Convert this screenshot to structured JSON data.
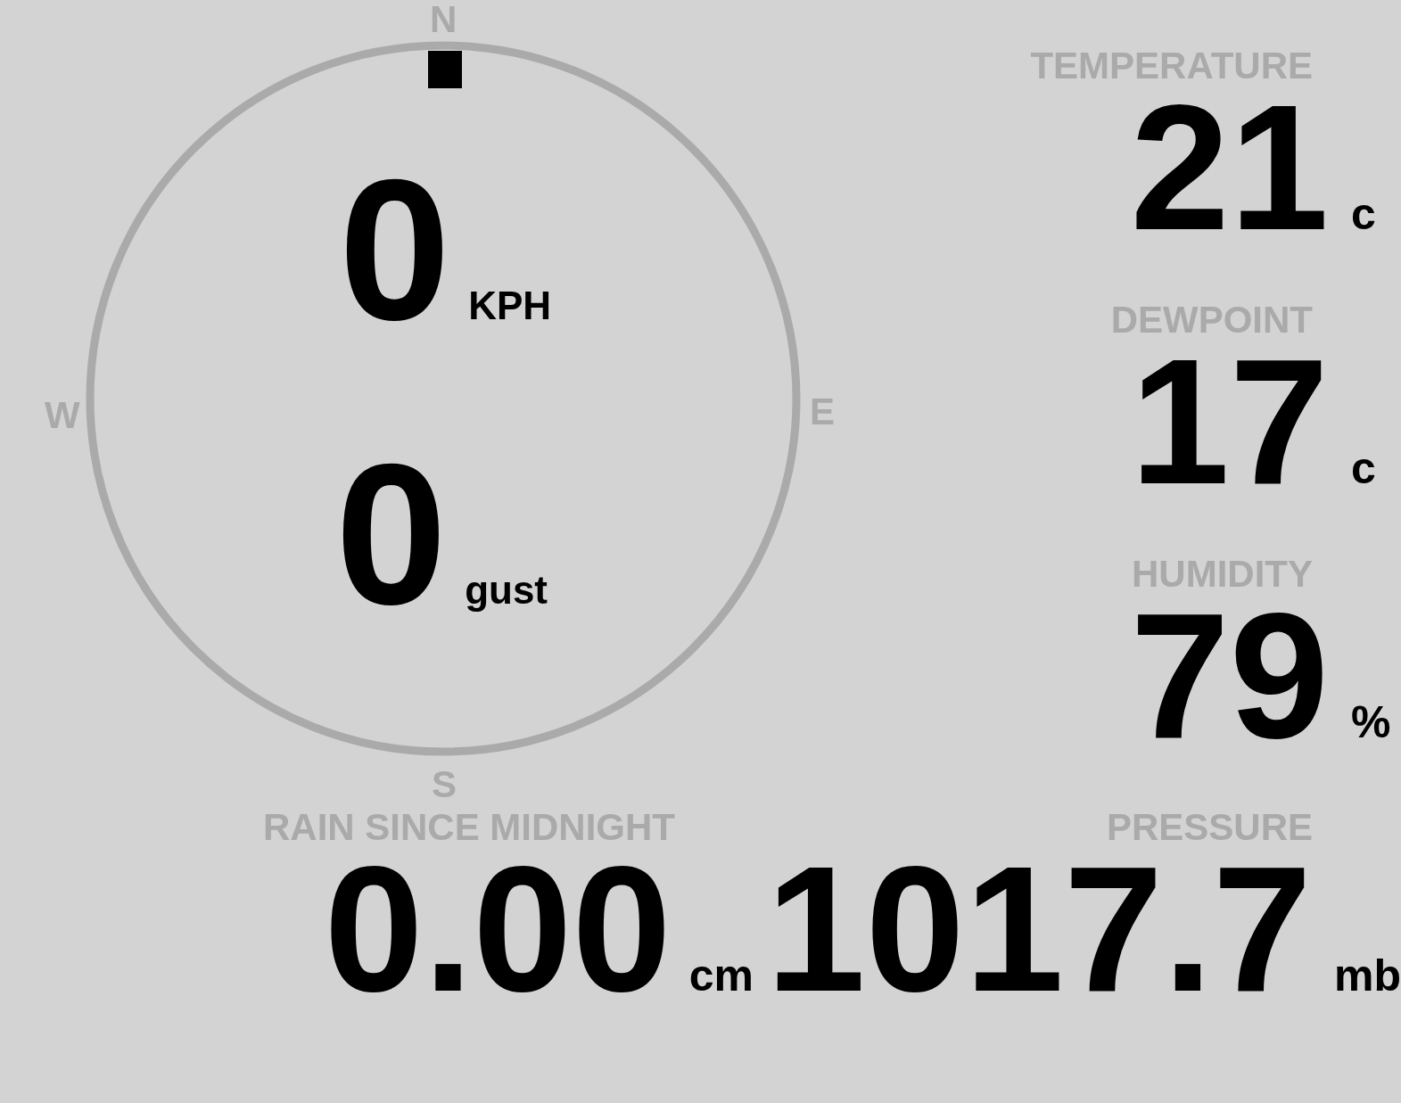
{
  "compass": {
    "points": [
      {
        "label": "N"
      },
      {
        "label": "E"
      },
      {
        "label": "S"
      },
      {
        "label": "W"
      }
    ]
  },
  "wind": [
    {
      "value": "0",
      "unit": "KPH"
    },
    {
      "value": "0",
      "unit": "gust"
    }
  ],
  "readings": [
    {
      "label": "TEMPERATURE",
      "value": "21",
      "unit": "c"
    },
    {
      "label": "DEWPOINT",
      "value": "17",
      "unit": "c"
    },
    {
      "label": "HUMIDITY",
      "value": "79",
      "unit": "%"
    }
  ],
  "rain": {
    "label": "RAIN SINCE MIDNIGHT",
    "value": "0.00",
    "unit": "cm"
  },
  "pressure": {
    "label": "PRESSURE",
    "value": "1017.7",
    "unit": "mb"
  }
}
